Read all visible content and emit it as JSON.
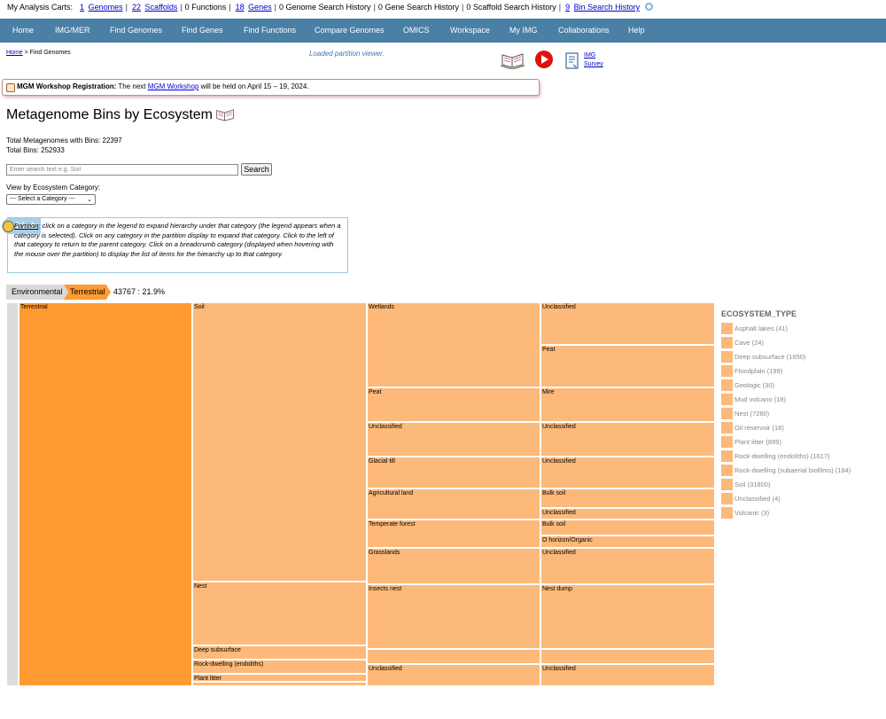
{
  "carts": {
    "label": "My Analysis Carts:",
    "items": [
      {
        "count": "1",
        "label": "Genomes",
        "linked": true
      },
      {
        "count": "22",
        "label": "Scaffolds",
        "linked": true
      },
      {
        "count": "0",
        "label": "Functions",
        "linked": false
      },
      {
        "count": "18",
        "label": "Genes",
        "linked": true
      },
      {
        "count": "0",
        "label": "Genome Search History",
        "linked": false
      },
      {
        "count": "0",
        "label": "Gene Search History",
        "linked": false
      },
      {
        "count": "0",
        "label": "Scaffold Search History",
        "linked": false
      },
      {
        "count": "9",
        "label": "Bin Search History",
        "linked": true
      }
    ]
  },
  "nav": [
    "Home",
    "IMG/MER",
    "Find Genomes",
    "Find Genes",
    "Find Functions",
    "Compare Genomes",
    "OMICS",
    "Workspace",
    "My IMG",
    "Collaborations",
    "Help"
  ],
  "breadcrumb": {
    "home": "Home",
    "current": "> Find Genomes"
  },
  "status": "Loaded partition viewer.",
  "survey": {
    "line1": "IMG",
    "line2": "Survey"
  },
  "banner": {
    "bold": "MGM Workshop Registration:",
    "pre": "The next",
    "link": "MGM Workshop",
    "post": "will be held on April 15 – 19, 2024."
  },
  "page_title": "Metagenome Bins by Ecosystem",
  "totals": {
    "metagenomes": "Total Metagenomes with Bins: 22397",
    "bins": "Total Bins: 252933"
  },
  "search": {
    "placeholder": "Enter search text e.g. Soil",
    "button": "Search"
  },
  "view_label": "View by Ecosystem Category:",
  "select_value": "--- Select a Category ---",
  "hint": {
    "badge": "hint:",
    "link": "Partition",
    "text": ": click on a category in the legend to expand hierarchy under that category (the legend appears when a category is selected). Click on any category in the partition display to expand that category. Click to the left of that category to return to the parent category. Click on a breadcrumb category (displayed when hovering with the mouse over the partition) to display the list of items for the hierarchy up to that category."
  },
  "trail": {
    "level1": "Environmental",
    "level2": "Terrestrial",
    "value": "43767 : 21.9%"
  },
  "legend": {
    "title": "ECOSYSTEM_TYPE",
    "items": [
      {
        "label": "Asphalt lakes (41)"
      },
      {
        "label": "Cave (24)"
      },
      {
        "label": "Deep subsurface (1650)"
      },
      {
        "label": "Floodplain (199)"
      },
      {
        "label": "Geologic (30)"
      },
      {
        "label": "Mud volcano (18)"
      },
      {
        "label": "Nest (7280)"
      },
      {
        "label": "Oil reservoir (18)"
      },
      {
        "label": "Plant litter (899)"
      },
      {
        "label": "Rock-dwelling (endoliths) (1617)"
      },
      {
        "label": "Rock-dwelling (subaerial biofilms) (184)"
      },
      {
        "label": "Soil (31800)"
      },
      {
        "label": "Unclassified (4)"
      },
      {
        "label": "Volcanic (3)"
      }
    ]
  },
  "partition": {
    "root": "Terrestrial",
    "colors": {
      "parent": "#dcdcdc",
      "selected": "#ff9a33",
      "child": "#fdb979"
    },
    "level2": [
      {
        "label": "Soil",
        "count": 31800
      },
      {
        "label": "Nest",
        "count": 7280
      },
      {
        "label": "Deep subsurface",
        "count": 1650
      },
      {
        "label": "Rock-dwelling (endoliths)",
        "count": 1617
      },
      {
        "label": "Plant litter",
        "count": 899
      },
      {
        "label": "",
        "count": 521
      }
    ],
    "level3": [
      {
        "label": "Wetlands",
        "count": 9600
      },
      {
        "label": "Peat",
        "count": 3900
      },
      {
        "label": "Unclassified",
        "count": 3900
      },
      {
        "label": "Glacial till",
        "count": 3600
      },
      {
        "label": "Agricultural land",
        "count": 3500
      },
      {
        "label": "Temperate forest",
        "count": 3200
      },
      {
        "label": "Grasslands",
        "count": 4100
      },
      {
        "label": "Insects nest",
        "count": 7300
      },
      {
        "label": "",
        "count": 1650
      },
      {
        "label": "Unclassified",
        "count": 2517
      }
    ],
    "level4": [
      {
        "label": "Unclassified",
        "count": 4800
      },
      {
        "label": "Peat",
        "count": 4800
      },
      {
        "label": "Mire",
        "count": 3900
      },
      {
        "label": "Unclassified",
        "count": 3900
      },
      {
        "label": "Unclassified",
        "count": 3600
      },
      {
        "label": "Bulk soil",
        "count": 2200
      },
      {
        "label": "Unclassified",
        "count": 1300
      },
      {
        "label": "Bulk soil",
        "count": 1800
      },
      {
        "label": "O horizon/Organic",
        "count": 1400
      },
      {
        "label": "Unclassified",
        "count": 4100
      },
      {
        "label": "Nest dump",
        "count": 7300
      },
      {
        "label": "",
        "count": 1650
      },
      {
        "label": "Unclassified",
        "count": 2517
      }
    ]
  }
}
